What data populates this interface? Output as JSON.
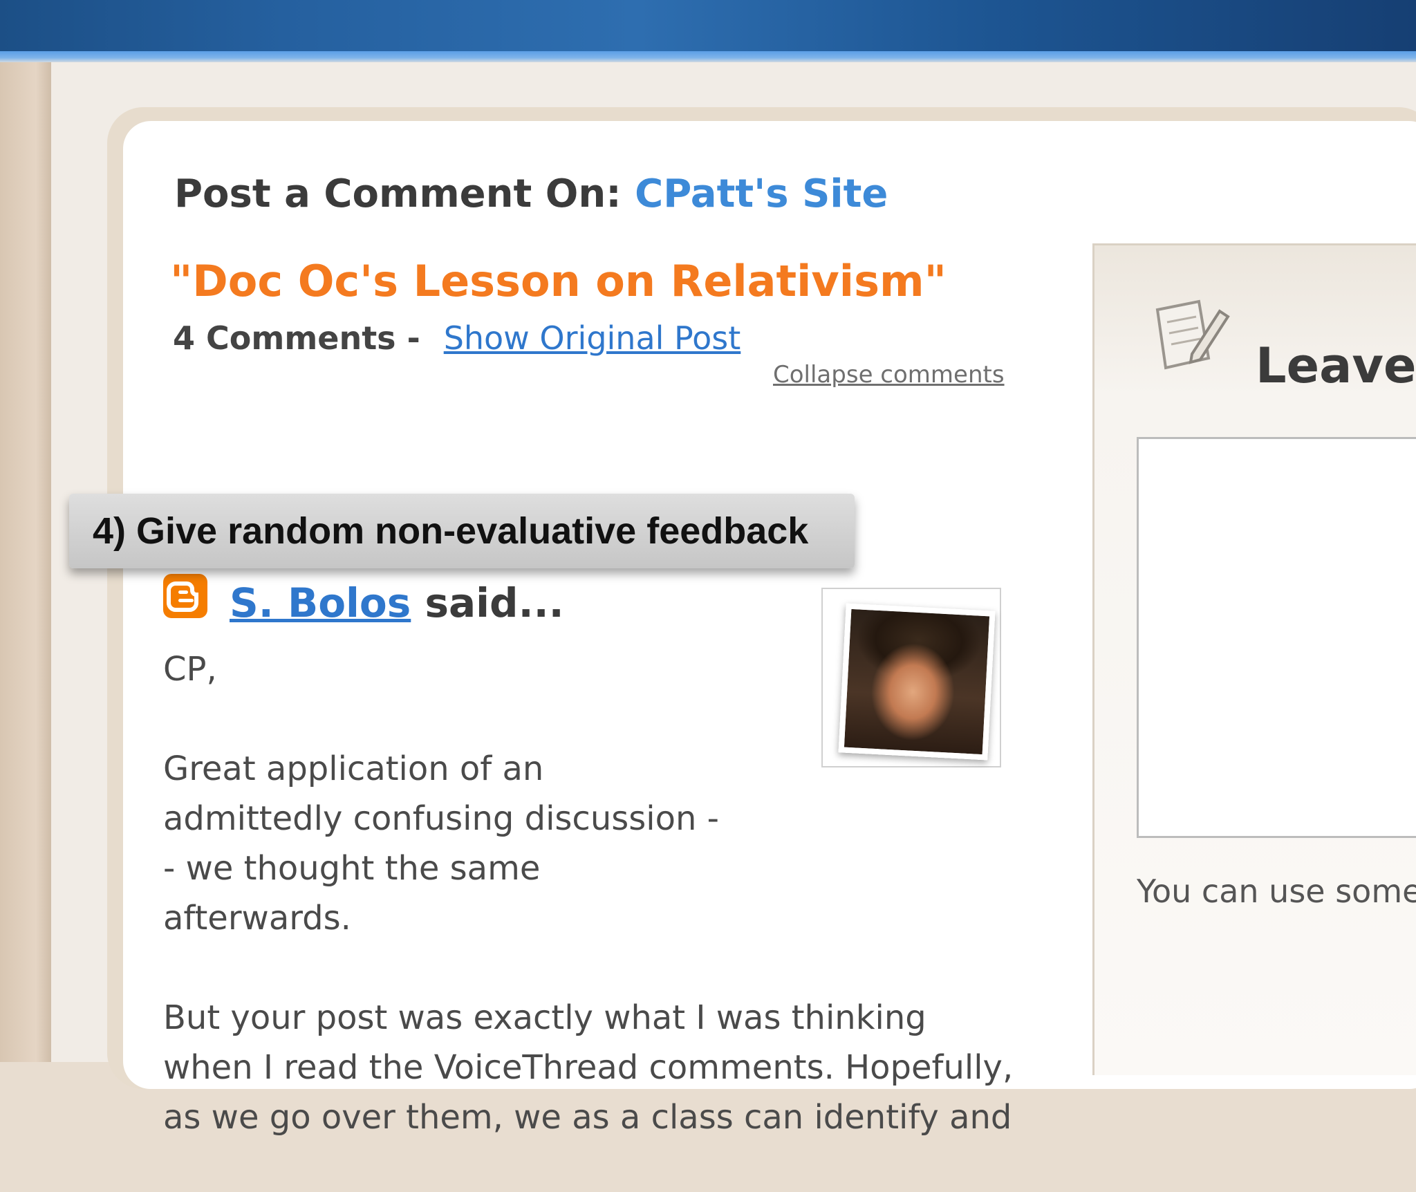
{
  "header": {
    "prefix": "Post a Comment On:",
    "site_name": "CPatt's Site"
  },
  "post": {
    "title": "\"Doc Oc's Lesson on Relativism\"",
    "comment_count": "4 Comments",
    "separator": "-",
    "show_original_label": "Show Original Post",
    "collapse_label": "Collapse comments"
  },
  "callout": {
    "text": "4) Give random non-evaluative feedback"
  },
  "comment": {
    "author": "S. Bolos",
    "said": "said...",
    "icon": "blogger-icon",
    "paragraphs": [
      "CP,",
      "Great application of an admittedly confusing discussion -- we thought the same afterwards.",
      "But your post was exactly what I was thinking when I read the VoiceThread comments. Hopefully, as we go over them, we as a class can identify and"
    ]
  },
  "side": {
    "heading": "Leave y",
    "icon": "notepad-pencil-icon",
    "note": "You can use some"
  },
  "colors": {
    "accent_blue": "#3d8ad8",
    "title_orange": "#f47a1f",
    "blogger_orange": "#f57d00",
    "topbar_blue": "#1c4f86"
  }
}
